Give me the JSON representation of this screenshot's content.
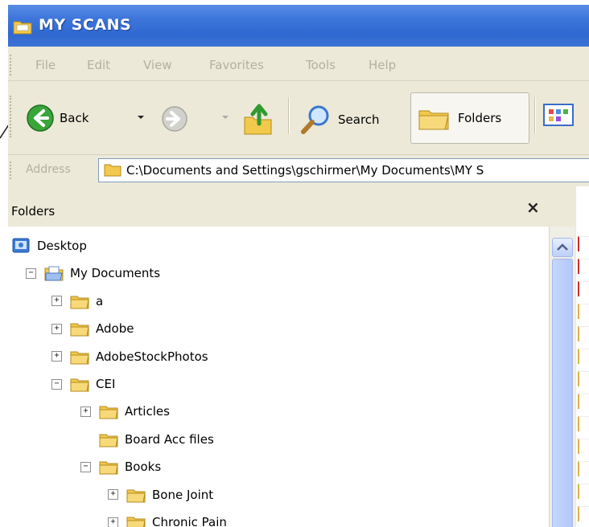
{
  "window": {
    "title": "MY SCANS"
  },
  "menu": [
    "File",
    "Edit",
    "View",
    "Favorites",
    "Tools",
    "Help"
  ],
  "toolbar": {
    "back_label": "Back",
    "search_label": "Search",
    "folders_label": "Folders"
  },
  "address": {
    "label": "Address",
    "value": "C:\\Documents and Settings\\gschirmer\\My Documents\\MY S"
  },
  "folders_pane": {
    "title": "Folders",
    "close_glyph": "×"
  },
  "tree": [
    {
      "label": "Desktop",
      "level": 0,
      "expander": "",
      "icon": "desktop-icon"
    },
    {
      "label": "My Documents",
      "level": 1,
      "expander": "−",
      "icon": "my-documents-icon"
    },
    {
      "label": "a",
      "level": 2,
      "expander": "+",
      "icon": "folder-icon"
    },
    {
      "label": "Adobe",
      "level": 2,
      "expander": "+",
      "icon": "folder-icon"
    },
    {
      "label": "AdobeStockPhotos",
      "level": 2,
      "expander": "+",
      "icon": "folder-icon"
    },
    {
      "label": "CEI",
      "level": 2,
      "expander": "−",
      "icon": "folder-icon"
    },
    {
      "label": "Articles",
      "level": 3,
      "expander": "+",
      "icon": "folder-icon"
    },
    {
      "label": "Board Acc files",
      "level": 3,
      "expander": "",
      "icon": "folder-icon"
    },
    {
      "label": "Books",
      "level": 3,
      "expander": "−",
      "icon": "folder-icon"
    },
    {
      "label": "Bone Joint",
      "level": 4,
      "expander": "+",
      "icon": "folder-icon"
    },
    {
      "label": "Chronic Pain",
      "level": 4,
      "expander": "+",
      "icon": "folder-icon"
    }
  ],
  "colors": {
    "titlebar": "#3f78dc",
    "chrome": "#ece9d8",
    "folder": "#f2c94c"
  }
}
